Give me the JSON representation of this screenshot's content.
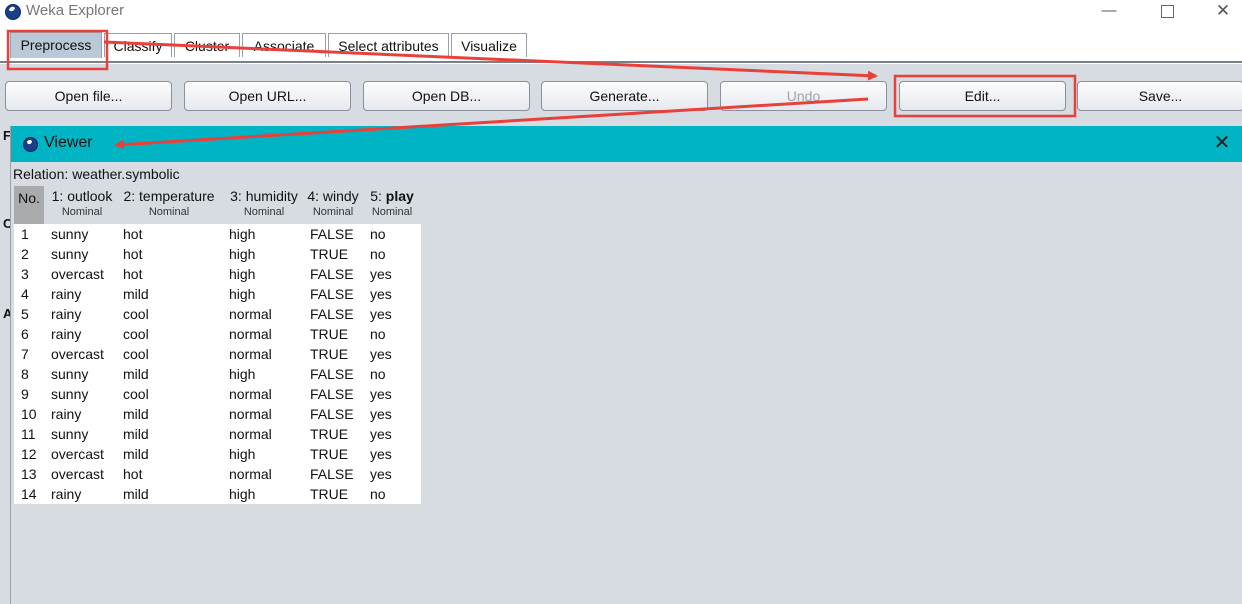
{
  "window": {
    "title": "Weka Explorer",
    "icon": "weka-bird-icon",
    "controls": [
      "—",
      "☐",
      "✕"
    ]
  },
  "tabs": [
    {
      "label": "Preprocess",
      "active": true
    },
    {
      "label": "Classify"
    },
    {
      "label": "Cluster"
    },
    {
      "label": "Associate"
    },
    {
      "label": "Select attributes"
    },
    {
      "label": "Visualize"
    }
  ],
  "toolbar": {
    "buttons": [
      {
        "label": "Open file...",
        "enabled": true
      },
      {
        "label": "Open URL...",
        "enabled": true
      },
      {
        "label": "Open DB...",
        "enabled": true
      },
      {
        "label": "Generate...",
        "enabled": true
      },
      {
        "label": "Undo",
        "enabled": false
      },
      {
        "label": "Edit...",
        "enabled": true
      },
      {
        "label": "Save...",
        "enabled": true
      }
    ]
  },
  "side_letters": [
    "F",
    "C",
    "A"
  ],
  "viewer": {
    "title": "Viewer",
    "close_symbol": "✕",
    "relation_label": "Relation:",
    "relation_name": "weather.symbolic",
    "columns": [
      {
        "index": "No.",
        "name": "",
        "type": ""
      },
      {
        "index": "1:",
        "name": "outlook",
        "type": "Nominal"
      },
      {
        "index": "2:",
        "name": "temperature",
        "type": "Nominal"
      },
      {
        "index": "3:",
        "name": "humidity",
        "type": "Nominal"
      },
      {
        "index": "4:",
        "name": "windy",
        "type": "Nominal"
      },
      {
        "index": "5:",
        "name": "play",
        "type": "Nominal"
      }
    ],
    "rows": [
      [
        "1",
        "sunny",
        "hot",
        "high",
        "FALSE",
        "no"
      ],
      [
        "2",
        "sunny",
        "hot",
        "high",
        "TRUE",
        "no"
      ],
      [
        "3",
        "overcast",
        "hot",
        "high",
        "FALSE",
        "yes"
      ],
      [
        "4",
        "rainy",
        "mild",
        "high",
        "FALSE",
        "yes"
      ],
      [
        "5",
        "rainy",
        "cool",
        "normal",
        "FALSE",
        "yes"
      ],
      [
        "6",
        "rainy",
        "cool",
        "normal",
        "TRUE",
        "no"
      ],
      [
        "7",
        "overcast",
        "cool",
        "normal",
        "TRUE",
        "yes"
      ],
      [
        "8",
        "sunny",
        "mild",
        "high",
        "FALSE",
        "no"
      ],
      [
        "9",
        "sunny",
        "cool",
        "normal",
        "FALSE",
        "yes"
      ],
      [
        "10",
        "rainy",
        "mild",
        "normal",
        "FALSE",
        "yes"
      ],
      [
        "11",
        "sunny",
        "mild",
        "normal",
        "TRUE",
        "yes"
      ],
      [
        "12",
        "overcast",
        "mild",
        "high",
        "TRUE",
        "yes"
      ],
      [
        "13",
        "overcast",
        "hot",
        "normal",
        "FALSE",
        "yes"
      ],
      [
        "14",
        "rainy",
        "mild",
        "high",
        "TRUE",
        "no"
      ]
    ]
  },
  "annotations": {
    "color": "#e8413b",
    "highlighted": [
      "Preprocess",
      "Edit...",
      "Viewer"
    ]
  },
  "colors": {
    "viewer_titlebar": "#00b4c3",
    "toolbar_bg": "#d7dbe2",
    "active_tab": "#b9c9d8"
  }
}
